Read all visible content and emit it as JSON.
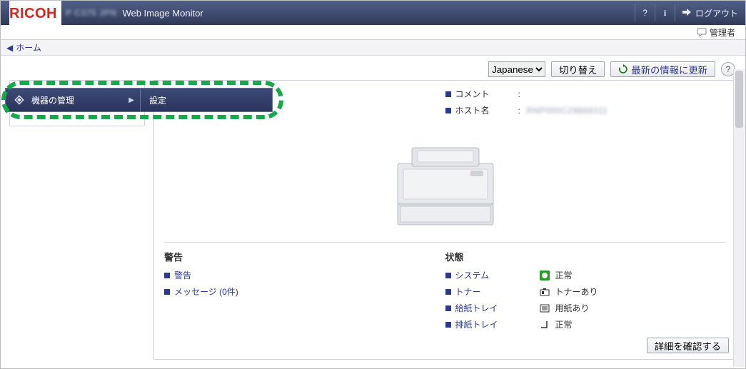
{
  "header": {
    "brand": "RICOH",
    "model_blur": "P C375 JPN",
    "app_name": "Web Image Monitor",
    "logout": "ログアウト"
  },
  "subbar": {
    "role": "管理者"
  },
  "breadcrumb": {
    "home": "ホーム"
  },
  "toolbar": {
    "language_options": [
      "Japanese"
    ],
    "language_selected": "Japanese",
    "switch": "切り替え",
    "refresh": "最新の情報に更新"
  },
  "device": {
    "name_blur": "■■■■■■■■■■",
    "comment_label": "コメント",
    "comment_value": "",
    "host_label": "ホスト名",
    "host_value_blur": "RNP000C29888311"
  },
  "alerts": {
    "heading": "警告",
    "alert_link": "警告",
    "messages_link": "メッセージ (0件)"
  },
  "status": {
    "heading": "状態",
    "rows": [
      {
        "link": "システム",
        "icon": "ok-green",
        "text": "正常"
      },
      {
        "link": "トナー",
        "icon": "toner",
        "text": "トナーあり"
      },
      {
        "link": "給紙トレイ",
        "icon": "paper",
        "text": "用紙あり"
      },
      {
        "link": "排紙トレイ",
        "icon": "output",
        "text": "正常"
      }
    ]
  },
  "detail_button": "詳細を確認する",
  "nav": {
    "item": "機器の管理",
    "sub": "設定"
  }
}
